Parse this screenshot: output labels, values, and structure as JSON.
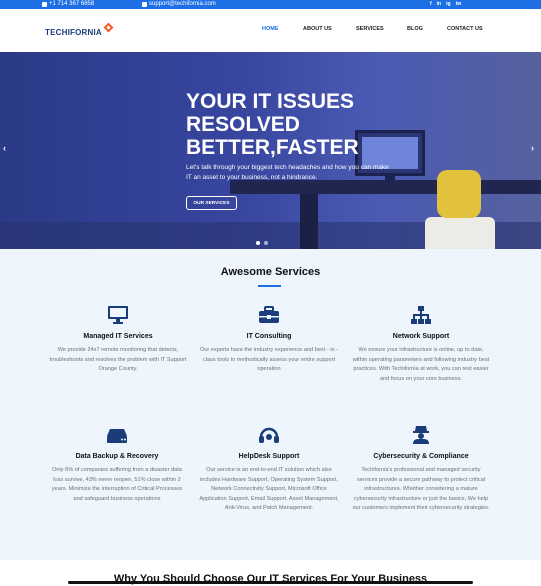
{
  "topbar": {
    "phone": "+1 714 367 6858",
    "email": "support@techifornia.com",
    "socials": [
      "f",
      "in",
      "ig",
      "tw"
    ]
  },
  "header": {
    "logo_text": "TECHIFORNIA",
    "nav": [
      "HOME",
      "ABOUT US",
      "SERVICES",
      "BLOG",
      "CONTACT US"
    ],
    "active_nav": "HOME"
  },
  "hero": {
    "title_lines": [
      "YOUR IT ISSUES",
      "RESOLVED",
      "BETTER,FASTER"
    ],
    "subtitle": "Let's talk through your biggest tech headaches and how you can make IT an asset to your business, not a hindrance.",
    "button": "OUR SERVICES",
    "prev_arrow": "‹",
    "next_arrow": "›",
    "slides": 2,
    "active_slide": 1
  },
  "services": {
    "title": "Awesome Services",
    "items": [
      {
        "icon": "monitor-icon",
        "title": "Managed IT Services",
        "text": "We provide 24x7 remote monitoring that detects, troubleshoots and resolves the problem with IT Support Orange County."
      },
      {
        "icon": "briefcase-icon",
        "title": "IT Consulting",
        "text": "Our experts have the industry experience and best - in - class tools to methodically assess your entire support operation"
      },
      {
        "icon": "network-icon",
        "title": "Network Support",
        "text": "We ensure your infrastructure is online, up to date, within operating parameters and following industry best practices. With Techifornia at work, you can rest easier and focus on your core business."
      },
      {
        "icon": "hard-drive-icon",
        "title": "Data Backup & Recovery",
        "text": "Only 6% of companies suffering from a disaster data loss survive, 43% never reopen, 51% close within 2 years. Minimize the interruption of Critical Processes and safeguard business operations"
      },
      {
        "icon": "headset-icon",
        "title": "HelpDesk Support",
        "text": "Our service is an end-to-end IT solution which also includes Hardware Support, Operating System Support, Network Connectivity Support, Microsoft Office Application Support, Email Support, Asset Management, Anti-Virus, and Patch Management."
      },
      {
        "icon": "spy-icon",
        "title": "Cybersecurity & Compliance",
        "text": "Techifornia's professional and managed security services provide a secure pathway to protect critical infrastructures. Whether considering a mature cybersecurity infrastructure or just the basics, We help our customers implement their cybersecurity strategies."
      }
    ]
  },
  "bottom": {
    "title": "Why You Should Choose Our IT Services For Your Business"
  },
  "colors": {
    "brand_blue": "#1e6fe6",
    "logo_navy": "#1b3c7a",
    "logo_orange": "#f05a28",
    "services_bg": "#eef5fd"
  }
}
